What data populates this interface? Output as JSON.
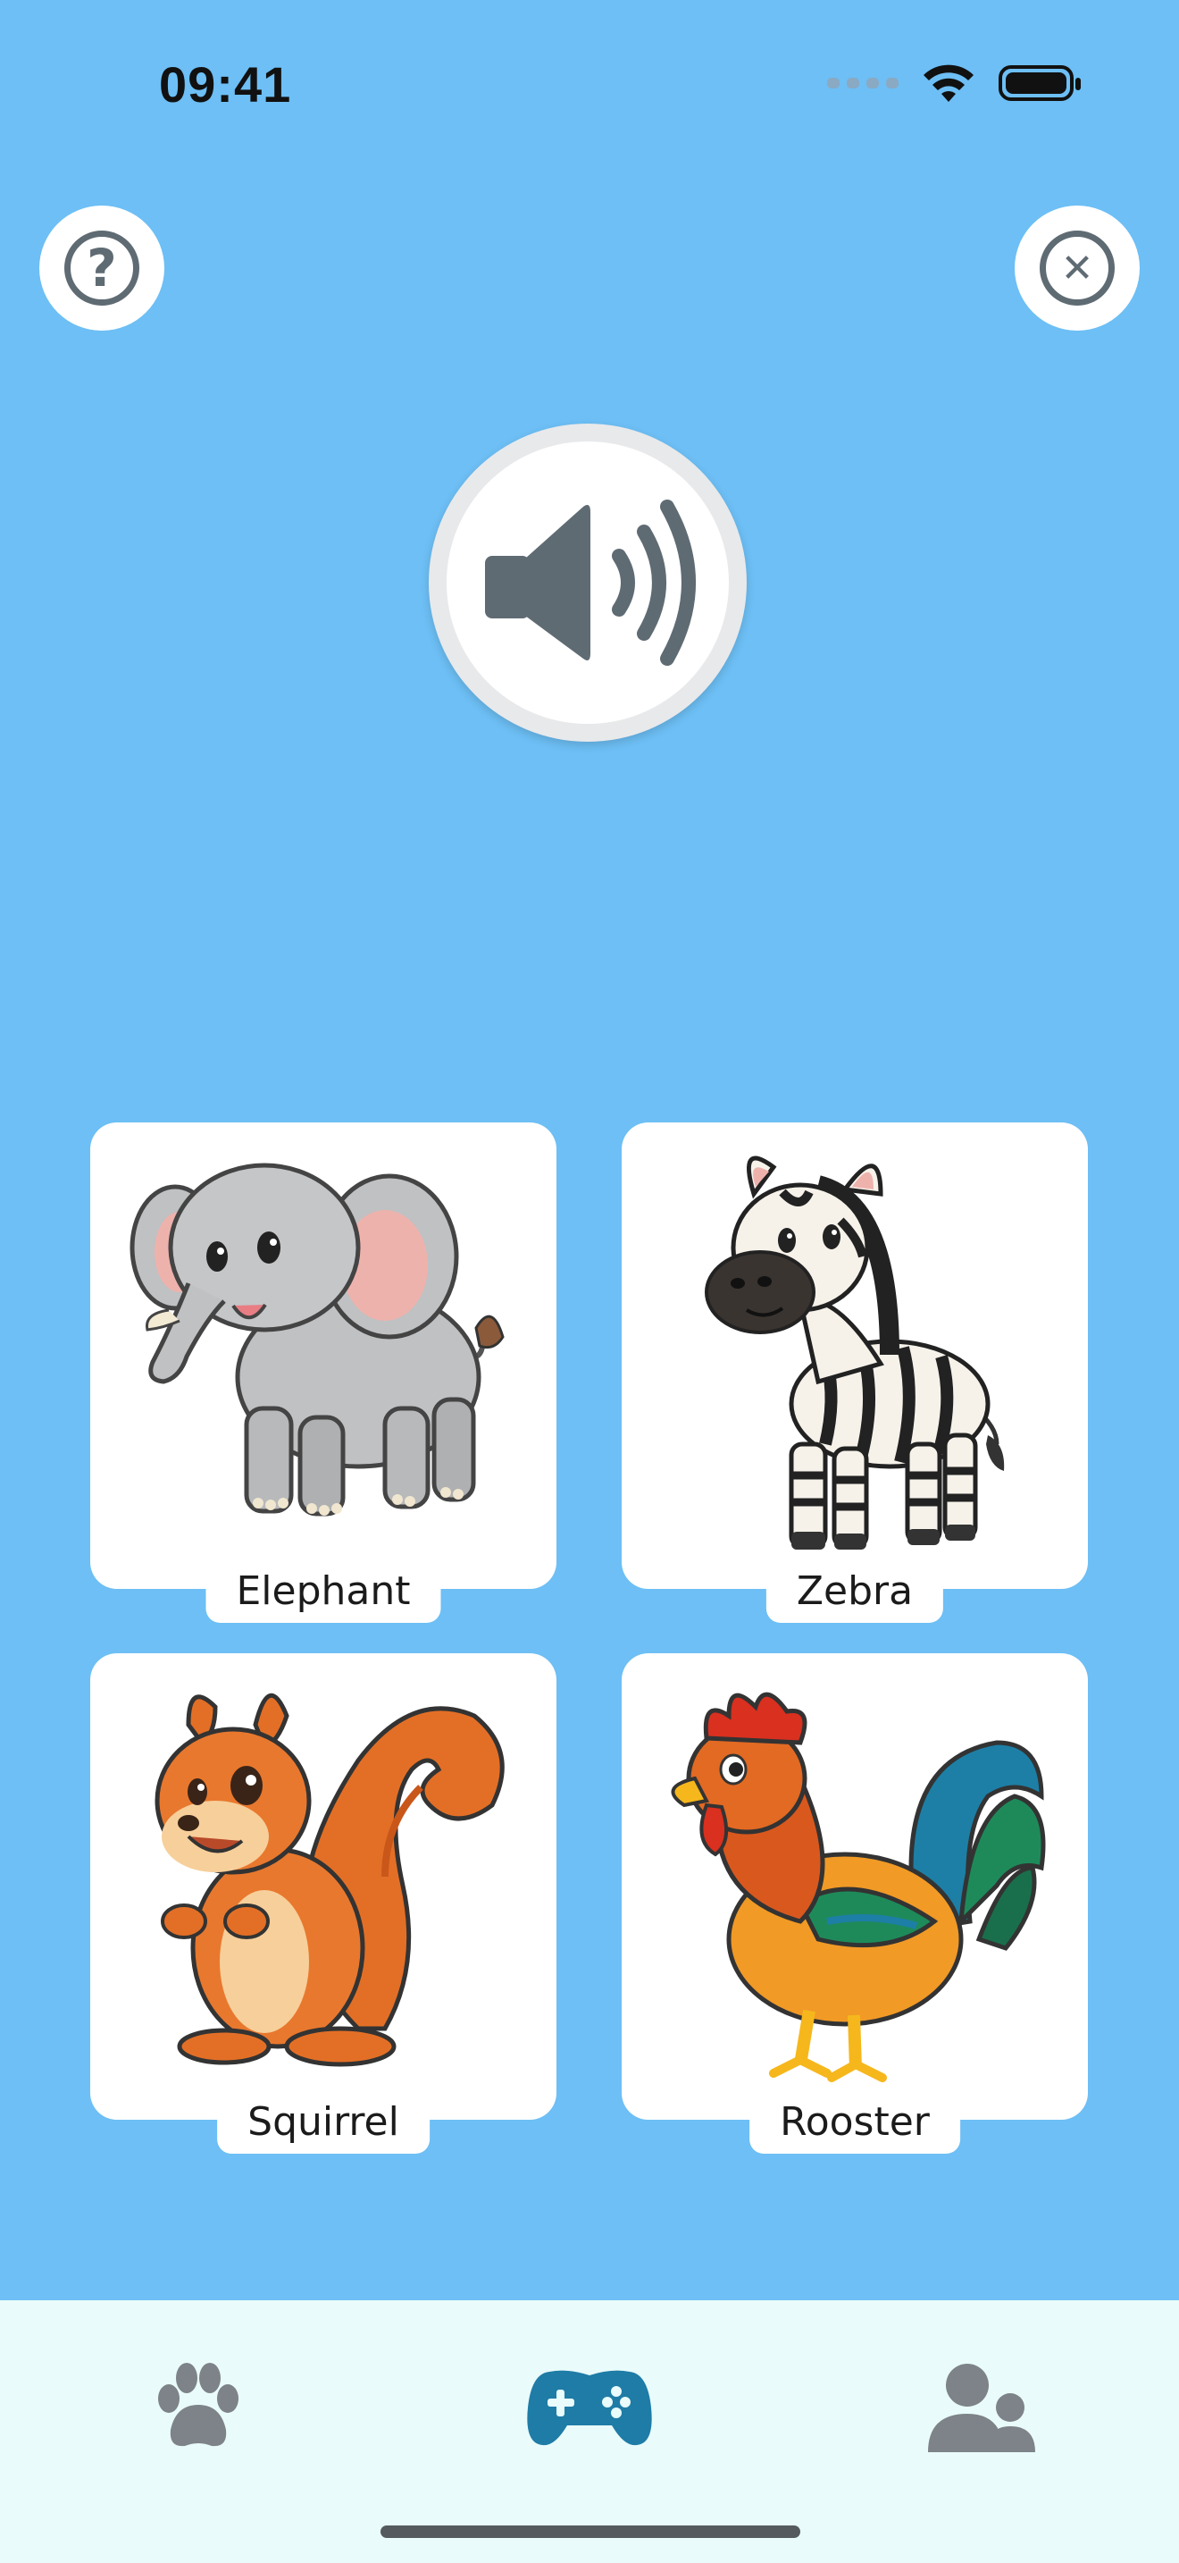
{
  "status_bar": {
    "time": "09:41",
    "icons": [
      "cellular-signal-icon",
      "wifi-icon",
      "battery-icon"
    ]
  },
  "header": {
    "help_button_icon": "question-circle-icon",
    "help_button_glyph": "?",
    "close_button_icon": "close-circle-icon",
    "close_button_glyph": "✕"
  },
  "audio": {
    "play_button_icon": "speaker-volume-icon"
  },
  "cards": [
    {
      "label": "Elephant",
      "icon": "elephant-illustration"
    },
    {
      "label": "Zebra",
      "icon": "zebra-illustration"
    },
    {
      "label": "Squirrel",
      "icon": "squirrel-illustration"
    },
    {
      "label": "Rooster",
      "icon": "rooster-illustration"
    }
  ],
  "tab_bar": {
    "tabs": [
      {
        "icon": "paw-icon",
        "active": false
      },
      {
        "icon": "gamepad-icon",
        "active": true
      },
      {
        "icon": "users-icon",
        "active": false
      }
    ]
  },
  "colors": {
    "background": "#6dbff5",
    "card": "#ffffff",
    "tab_bar": "#e9fbfb",
    "icon_inactive": "#7d8388",
    "icon_active": "#1e7ca6",
    "button_icon": "#5f6b73"
  }
}
